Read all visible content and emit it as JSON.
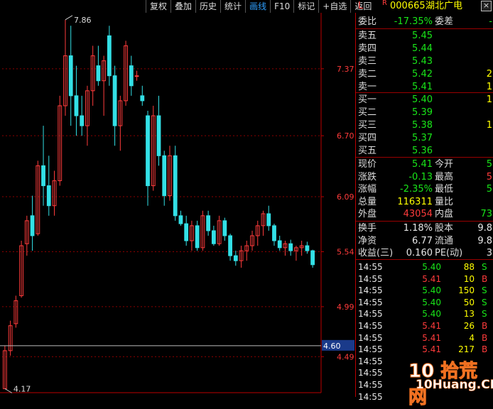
{
  "toolbar": {
    "items": [
      "复权",
      "叠加",
      "历史",
      "统计",
      "画线",
      "F10",
      "标记",
      "+自选",
      "返回"
    ],
    "active_index": 4,
    "close_symbol": "×"
  },
  "header": {
    "flag": "L",
    "r_badge": "R",
    "code": "000665",
    "name": "湖北广电"
  },
  "order_ratio": {
    "label": "委比",
    "value": "-17.35%",
    "label2": "委差",
    "value2": "-"
  },
  "asks": [
    {
      "label": "卖五",
      "price": "5.45",
      "vol": ""
    },
    {
      "label": "卖四",
      "price": "5.44",
      "vol": ""
    },
    {
      "label": "卖三",
      "price": "5.43",
      "vol": ""
    },
    {
      "label": "卖二",
      "price": "5.42",
      "vol": "2"
    },
    {
      "label": "卖一",
      "price": "5.41",
      "vol": "1"
    }
  ],
  "bids": [
    {
      "label": "买一",
      "price": "5.40",
      "vol": "1"
    },
    {
      "label": "买二",
      "price": "5.39",
      "vol": ""
    },
    {
      "label": "买三",
      "price": "5.38",
      "vol": "1"
    },
    {
      "label": "买四",
      "price": "5.37",
      "vol": ""
    },
    {
      "label": "买五",
      "price": "5.36",
      "vol": ""
    }
  ],
  "quote": [
    {
      "l1": "现价",
      "v1": "5.41",
      "l2": "今开",
      "v2": "5"
    },
    {
      "l1": "涨跌",
      "v1": "-0.13",
      "l2": "最高",
      "v2": "5"
    },
    {
      "l1": "涨幅",
      "v1": "-2.35%",
      "l2": "最低",
      "v2": "5"
    },
    {
      "l1": "总量",
      "v1": "116311",
      "l2": "量比",
      "v2": ""
    },
    {
      "l1": "外盘",
      "v1": "43054",
      "l2": "内盘",
      "v2": "73"
    }
  ],
  "fundamentals": [
    {
      "l1": "换手",
      "v1": "1.18%",
      "l2": "股本",
      "v2": "9.8"
    },
    {
      "l1": "净资",
      "v1": "6.77",
      "l2": "流通",
      "v2": "9.8"
    },
    {
      "l1": "收益(三)",
      "v1": "0.160",
      "l2": "PE(动)",
      "v2": "3"
    }
  ],
  "ticks": [
    {
      "time": "14:55",
      "price": "5.40",
      "vol": "88",
      "dir": "S"
    },
    {
      "time": "14:55",
      "price": "5.41",
      "vol": "10",
      "dir": "B"
    },
    {
      "time": "14:55",
      "price": "5.40",
      "vol": "150",
      "dir": "S"
    },
    {
      "time": "14:55",
      "price": "5.40",
      "vol": "50",
      "dir": "S"
    },
    {
      "time": "14:55",
      "price": "5.40",
      "vol": "13",
      "dir": "S"
    },
    {
      "time": "14:55",
      "price": "5.41",
      "vol": "26",
      "dir": "B"
    },
    {
      "time": "14:55",
      "price": "5.41",
      "vol": "4",
      "dir": "B"
    },
    {
      "time": "14:55",
      "price": "5.41",
      "vol": "217",
      "dir": "B"
    },
    {
      "time": "14:55",
      "price": "",
      "vol": "",
      "dir": ""
    },
    {
      "time": "14:55",
      "price": "",
      "vol": "",
      "dir": ""
    },
    {
      "time": "14:55",
      "price": "",
      "vol": "",
      "dir": ""
    },
    {
      "time": "14:55",
      "price": "",
      "vol": "",
      "dir": ""
    }
  ],
  "watermark": {
    "line1": "10 拾荒网",
    "line2": "10Huang.CN"
  },
  "colors": {
    "up": "#ff3b3b",
    "down": "#33e0e6",
    "grid": "#8b0000",
    "price_label": "#ff3b3b",
    "crosshair_bg": "#1a3a8a"
  },
  "chart_data": {
    "type": "candlestick",
    "y_ticks": [
      4.49,
      4.99,
      5.54,
      6.09,
      6.7,
      7.37
    ],
    "ylim": [
      4.13,
      7.93
    ],
    "annotations": [
      {
        "text": "7.86",
        "value": 7.86
      },
      {
        "text": "4.17",
        "value": 4.17
      }
    ],
    "crosshair": {
      "label": "4.60",
      "value": 4.6
    },
    "candles": [
      {
        "o": 4.17,
        "h": 4.6,
        "l": 4.17,
        "c": 4.55
      },
      {
        "o": 4.55,
        "h": 4.85,
        "l": 4.5,
        "c": 4.8
      },
      {
        "o": 4.82,
        "h": 5.1,
        "l": 4.78,
        "c": 5.05
      },
      {
        "o": 5.1,
        "h": 5.65,
        "l": 5.08,
        "c": 5.6
      },
      {
        "o": 5.62,
        "h": 5.9,
        "l": 5.5,
        "c": 5.85
      },
      {
        "o": 5.9,
        "h": 6.1,
        "l": 5.55,
        "c": 5.7
      },
      {
        "o": 5.72,
        "h": 6.45,
        "l": 5.7,
        "c": 6.4
      },
      {
        "o": 6.4,
        "h": 6.8,
        "l": 6.0,
        "c": 6.2
      },
      {
        "o": 6.2,
        "h": 6.5,
        "l": 5.9,
        "c": 6.0
      },
      {
        "o": 6.0,
        "h": 6.35,
        "l": 5.9,
        "c": 6.25
      },
      {
        "o": 6.25,
        "h": 7.1,
        "l": 6.2,
        "c": 7.0
      },
      {
        "o": 7.0,
        "h": 7.86,
        "l": 6.9,
        "c": 7.5
      },
      {
        "o": 7.5,
        "h": 7.8,
        "l": 6.8,
        "c": 7.1
      },
      {
        "o": 7.1,
        "h": 7.4,
        "l": 6.7,
        "c": 6.9
      },
      {
        "o": 6.9,
        "h": 7.1,
        "l": 6.7,
        "c": 6.8
      },
      {
        "o": 6.8,
        "h": 7.2,
        "l": 6.6,
        "c": 7.15
      },
      {
        "o": 7.15,
        "h": 7.6,
        "l": 7.0,
        "c": 7.5
      },
      {
        "o": 7.4,
        "h": 7.6,
        "l": 7.2,
        "c": 7.25
      },
      {
        "o": 7.25,
        "h": 7.5,
        "l": 6.9,
        "c": 7.45
      },
      {
        "o": 7.7,
        "h": 7.8,
        "l": 7.2,
        "c": 7.3
      },
      {
        "o": 7.3,
        "h": 7.4,
        "l": 6.6,
        "c": 6.8
      },
      {
        "o": 6.8,
        "h": 7.1,
        "l": 6.55,
        "c": 7.05
      },
      {
        "o": 7.05,
        "h": 7.65,
        "l": 7.0,
        "c": 7.6
      },
      {
        "o": 7.4,
        "h": 7.5,
        "l": 7.1,
        "c": 7.2
      },
      {
        "o": 7.3,
        "h": 7.35,
        "l": 7.25,
        "c": 7.3
      },
      {
        "o": 7.1,
        "h": 7.2,
        "l": 7.0,
        "c": 7.05
      },
      {
        "o": 6.9,
        "h": 6.95,
        "l": 6.0,
        "c": 6.2
      },
      {
        "o": 6.2,
        "h": 7.0,
        "l": 6.15,
        "c": 6.9
      },
      {
        "o": 6.9,
        "h": 7.1,
        "l": 6.4,
        "c": 6.5
      },
      {
        "o": 6.5,
        "h": 6.55,
        "l": 6.0,
        "c": 6.1
      },
      {
        "o": 6.1,
        "h": 6.6,
        "l": 6.05,
        "c": 6.5
      },
      {
        "o": 6.5,
        "h": 6.6,
        "l": 5.85,
        "c": 5.9
      },
      {
        "o": 5.9,
        "h": 5.95,
        "l": 5.8,
        "c": 5.82
      },
      {
        "o": 5.82,
        "h": 5.9,
        "l": 5.6,
        "c": 5.65
      },
      {
        "o": 5.65,
        "h": 5.85,
        "l": 5.55,
        "c": 5.8
      },
      {
        "o": 5.8,
        "h": 5.85,
        "l": 5.55,
        "c": 5.58
      },
      {
        "o": 5.58,
        "h": 5.95,
        "l": 5.55,
        "c": 5.9
      },
      {
        "o": 5.9,
        "h": 5.95,
        "l": 5.7,
        "c": 5.75
      },
      {
        "o": 5.75,
        "h": 5.8,
        "l": 5.6,
        "c": 5.62
      },
      {
        "o": 5.62,
        "h": 5.9,
        "l": 5.6,
        "c": 5.85
      },
      {
        "o": 5.85,
        "h": 5.88,
        "l": 5.65,
        "c": 5.7
      },
      {
        "o": 5.7,
        "h": 5.72,
        "l": 5.45,
        "c": 5.5
      },
      {
        "o": 5.5,
        "h": 5.55,
        "l": 5.4,
        "c": 5.45
      },
      {
        "o": 5.45,
        "h": 5.6,
        "l": 5.38,
        "c": 5.55
      },
      {
        "o": 5.55,
        "h": 5.65,
        "l": 5.45,
        "c": 5.6
      },
      {
        "o": 5.6,
        "h": 5.75,
        "l": 5.55,
        "c": 5.7
      },
      {
        "o": 5.7,
        "h": 5.85,
        "l": 5.6,
        "c": 5.8
      },
      {
        "o": 5.8,
        "h": 5.95,
        "l": 5.7,
        "c": 5.92
      },
      {
        "o": 5.92,
        "h": 6.0,
        "l": 5.75,
        "c": 5.8
      },
      {
        "o": 5.8,
        "h": 5.82,
        "l": 5.6,
        "c": 5.65
      },
      {
        "o": 5.65,
        "h": 5.7,
        "l": 5.55,
        "c": 5.58
      },
      {
        "o": 5.58,
        "h": 5.65,
        "l": 5.5,
        "c": 5.62
      },
      {
        "o": 5.62,
        "h": 5.66,
        "l": 5.5,
        "c": 5.55
      },
      {
        "o": 5.55,
        "h": 5.6,
        "l": 5.45,
        "c": 5.58
      },
      {
        "o": 5.58,
        "h": 5.65,
        "l": 5.5,
        "c": 5.6
      },
      {
        "o": 5.6,
        "h": 5.64,
        "l": 5.52,
        "c": 5.55
      },
      {
        "o": 5.55,
        "h": 5.56,
        "l": 5.38,
        "c": 5.41
      }
    ]
  }
}
